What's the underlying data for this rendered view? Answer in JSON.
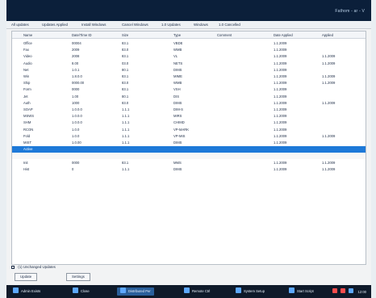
{
  "window": {
    "title": "Fathom - ar - V"
  },
  "menu": {
    "items": [
      "All updates",
      "Updates Applied",
      "Install Windows",
      "Cancel Windows",
      "1.0 Updates",
      "Windows",
      "1.0 Cancelled"
    ]
  },
  "table": {
    "headers": [
      "Name",
      "Date/Time ID",
      "Size",
      "Type",
      "Comment",
      "Date Applied",
      "Applied"
    ],
    "rows": [
      [
        "Office",
        "00004",
        "83.1",
        "VBDE",
        "",
        "1.1.2009",
        ""
      ],
      [
        "Fax",
        "2009",
        "83.0",
        "WMB",
        "",
        "1.1.2009",
        ""
      ],
      [
        "Video",
        "2008",
        "83.1",
        "VL",
        "",
        "1.1.2009",
        "1.1.2009"
      ],
      [
        "Audio",
        "8.00",
        "03.0",
        "NETS",
        "",
        "1.1.2009",
        "1.1.2009"
      ],
      [
        "Net",
        "1.0.1",
        "80.1",
        "DIMS",
        "",
        "1.1.2009",
        ""
      ],
      [
        "Win",
        "1.8.0.0",
        "83.1",
        "MIME",
        "",
        "1.1.2009",
        "1.1.2009"
      ],
      [
        "Ship",
        "0000.00",
        "83.0",
        "WMB",
        "",
        "1.1.2009",
        "1.1.2009"
      ],
      [
        "Form",
        "0000",
        "83.1",
        "VSH",
        "",
        "1.1.2009",
        ""
      ],
      [
        "Jet",
        "1.00",
        "80.1",
        "DIS",
        "",
        "1.1.2009",
        ""
      ],
      [
        "Auth",
        "1000",
        "83.0",
        "DIMS",
        "",
        "1.1.2009",
        "1.1.2009"
      ],
      [
        "SOAP",
        "1.0.0.0",
        "1.1.1",
        "DIM-S",
        "",
        "1.1.2009",
        ""
      ],
      [
        "MSWS",
        "1.0.0.0",
        "1.1.1",
        "MIRS",
        "",
        "1.1.2009",
        ""
      ],
      [
        "SHM",
        "1.0.0.0",
        "1.1.1",
        "CHIMD",
        "",
        "1.1.2009",
        ""
      ],
      [
        "RCON",
        "1.0.0",
        "1.1.1",
        "VP-MARK",
        "",
        "1.1.2009",
        ""
      ],
      [
        "Fold",
        "1.0.0",
        "1.1.1",
        "VP-MIS",
        "",
        "1.1.2009",
        "1.1.2009"
      ],
      [
        "MIST",
        "1.0.00",
        "1.1.1",
        "DIMS",
        "",
        "1.1.2009",
        ""
      ],
      [
        "Active",
        "",
        "",
        "",
        "",
        "",
        ""
      ],
      [
        "",
        "",
        "",
        "",
        "",
        "",
        ""
      ],
      [
        "Init",
        "0000",
        "83.1",
        "MMS",
        "",
        "1.1.2009",
        "1.1.2009"
      ],
      [
        "Hist",
        "0",
        "1.1.1",
        "DIMS",
        "",
        "1.1.2009",
        "1.1.2009"
      ]
    ]
  },
  "footer": {
    "checkbox_label": "(1) Unchanged Updates",
    "button_left": "Update",
    "button_right": "Settings"
  },
  "taskbar": {
    "items": [
      "Admin Exists",
      "Close",
      "Distributed Per",
      "Remote Ctrl",
      "System Setup",
      "Start Script"
    ],
    "active_index": 2,
    "tray_text": "12:00"
  },
  "colors": {
    "title_bg": "#0b1f3a",
    "selection": "#1d79d8",
    "taskbar_bg": "#0f1a2a"
  }
}
